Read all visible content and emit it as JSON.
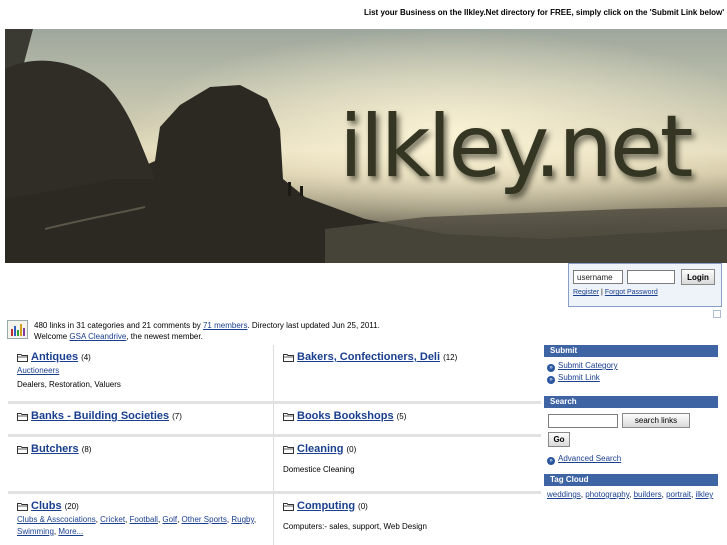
{
  "promo": "List your Business on the Ilkley.Net directory for FREE, simply click on the 'Submit Link below'",
  "banner": {
    "title": "ilkley.net"
  },
  "login": {
    "username_value": "username",
    "password_value": "",
    "login_label": "Login",
    "register_label": "Register",
    "separator": "|",
    "forgot_label": "Forgot Password"
  },
  "stats": {
    "line1_prefix": "480 links in 31 categories and 21 comments by ",
    "members_link": "71 members",
    "line1_suffix": ". Directory last updated Jun 25, 2011.",
    "line2_prefix": "Welcome ",
    "newest_member": "GSA Cleandrive",
    "line2_suffix": ", the newest member."
  },
  "categories": [
    {
      "title": "Antiques",
      "count": "(4)",
      "subs": [
        "Auctioneers"
      ],
      "more": "",
      "desc": "Dealers, Restoration, Valuers"
    },
    {
      "title": "Bakers, Confectioners, Deli",
      "count": "(12)",
      "subs": [],
      "more": "",
      "desc": ""
    },
    {
      "title": "Banks - Building Societies",
      "count": "(7)",
      "subs": [],
      "more": "",
      "desc": ""
    },
    {
      "title": "Books Bookshops",
      "count": "(5)",
      "subs": [],
      "more": "",
      "desc": ""
    },
    {
      "title": "Butchers",
      "count": "(8)",
      "subs": [],
      "more": "",
      "desc": ""
    },
    {
      "title": "Cleaning",
      "count": "(0)",
      "subs": [],
      "more": "",
      "desc": "Domestice Cleaning"
    },
    {
      "title": "Clubs",
      "count": "(20)",
      "subs": [
        "Clubs & Asscociations",
        "Cricket",
        "Football",
        "Golf",
        "Other Sports",
        "Rugby",
        "Swimming"
      ],
      "more": "More...",
      "desc": ""
    },
    {
      "title": "Computing",
      "count": "(0)",
      "subs": [],
      "more": "",
      "desc": "Computers:- sales, support, Web Design"
    }
  ],
  "sidebar": {
    "submit": {
      "heading": "Submit",
      "links": [
        "Submit Category",
        "Submit Link"
      ]
    },
    "search": {
      "heading": "Search",
      "input_value": "",
      "scope_label": "search links",
      "go_label": "Go",
      "advanced_label": "Advanced Search"
    },
    "tagcloud": {
      "heading": "Tag Cloud",
      "tags": [
        "weddings",
        "photography",
        "builders",
        "portrait",
        "ilkley"
      ]
    }
  },
  "colors": {
    "link": "#1a3f8f",
    "sidebar_header": "#3e64a4"
  }
}
